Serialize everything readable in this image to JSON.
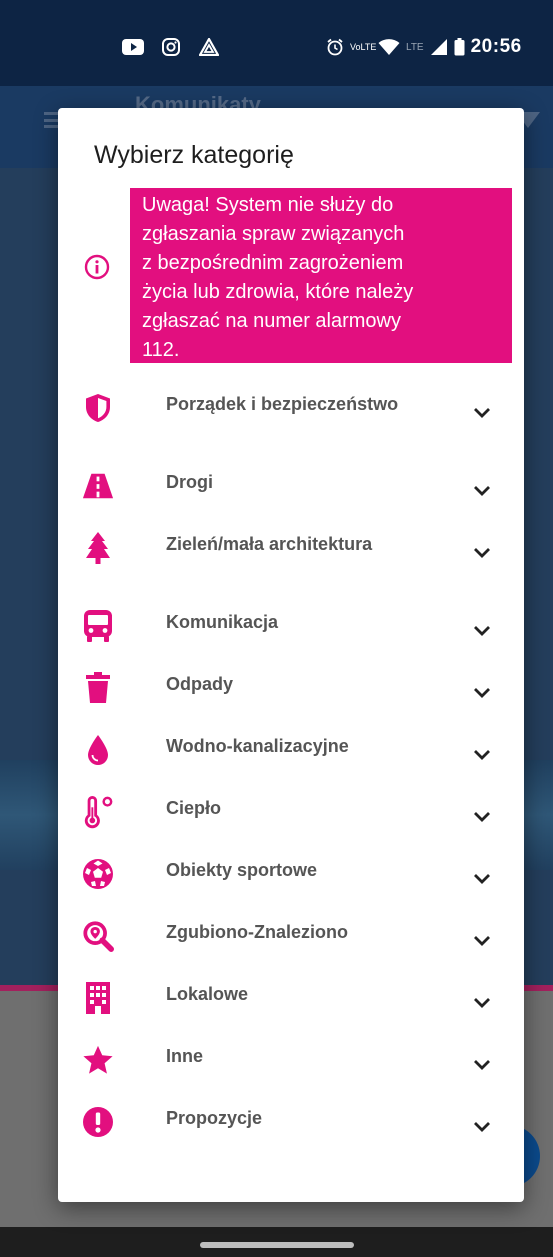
{
  "status_bar": {
    "time": "20:56",
    "lte_text": "LTE",
    "volte_text": "VoLTE",
    "left_icons": [
      "youtube-icon",
      "instagram-icon",
      "delta-icon"
    ],
    "right_icons": [
      "alarm-icon",
      "volte-icon",
      "wifi-icon",
      "signal-icon",
      "battery-icon"
    ]
  },
  "background": {
    "app_title": "Komunikaty"
  },
  "dialog": {
    "title": "Wybierz kategorię",
    "warning_lines": [
      "Uwaga! System nie służy do",
      "zgłaszania spraw związanych",
      "z bezpośrednim zagrożeniem",
      "życia lub zdrowia, które należy",
      "zgłaszać na numer alarmowy",
      "112."
    ],
    "accent_color": "#e20f7f",
    "categories": [
      {
        "label": "Porządek i bezpieczeństwo",
        "icon": "shield-icon"
      },
      {
        "label": "Drogi",
        "icon": "road-icon"
      },
      {
        "label": "Zieleń/mała architektura",
        "icon": "tree-icon"
      },
      {
        "label": "Komunikacja",
        "icon": "bus-icon"
      },
      {
        "label": "Odpady",
        "icon": "trash-icon"
      },
      {
        "label": "Wodno-kanalizacyjne",
        "icon": "water-drop-icon"
      },
      {
        "label": "Ciepło",
        "icon": "thermometer-icon"
      },
      {
        "label": "Obiekty sportowe",
        "icon": "football-icon"
      },
      {
        "label": "Zgubiono-Znaleziono",
        "icon": "search-icon"
      },
      {
        "label": "Lokalowe",
        "icon": "building-icon"
      },
      {
        "label": "Inne",
        "icon": "star-icon"
      },
      {
        "label": "Propozycje",
        "icon": "exclamation-icon"
      }
    ]
  }
}
